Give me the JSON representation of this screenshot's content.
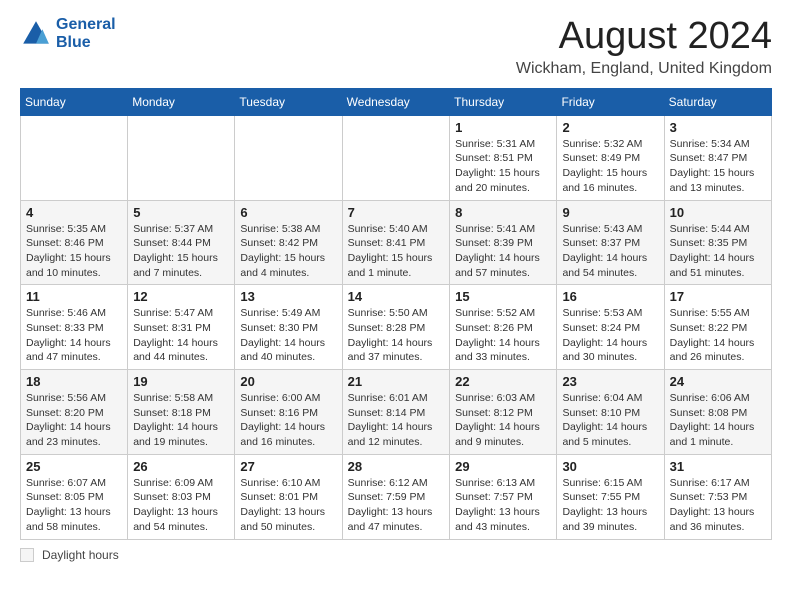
{
  "header": {
    "logo_line1": "General",
    "logo_line2": "Blue",
    "month_title": "August 2024",
    "location": "Wickham, England, United Kingdom"
  },
  "legend": {
    "label": "Daylight hours"
  },
  "days_of_week": [
    "Sunday",
    "Monday",
    "Tuesday",
    "Wednesday",
    "Thursday",
    "Friday",
    "Saturday"
  ],
  "weeks": [
    [
      {
        "day": "",
        "info": ""
      },
      {
        "day": "",
        "info": ""
      },
      {
        "day": "",
        "info": ""
      },
      {
        "day": "",
        "info": ""
      },
      {
        "day": "1",
        "info": "Sunrise: 5:31 AM\nSunset: 8:51 PM\nDaylight: 15 hours\nand 20 minutes."
      },
      {
        "day": "2",
        "info": "Sunrise: 5:32 AM\nSunset: 8:49 PM\nDaylight: 15 hours\nand 16 minutes."
      },
      {
        "day": "3",
        "info": "Sunrise: 5:34 AM\nSunset: 8:47 PM\nDaylight: 15 hours\nand 13 minutes."
      }
    ],
    [
      {
        "day": "4",
        "info": "Sunrise: 5:35 AM\nSunset: 8:46 PM\nDaylight: 15 hours\nand 10 minutes."
      },
      {
        "day": "5",
        "info": "Sunrise: 5:37 AM\nSunset: 8:44 PM\nDaylight: 15 hours\nand 7 minutes."
      },
      {
        "day": "6",
        "info": "Sunrise: 5:38 AM\nSunset: 8:42 PM\nDaylight: 15 hours\nand 4 minutes."
      },
      {
        "day": "7",
        "info": "Sunrise: 5:40 AM\nSunset: 8:41 PM\nDaylight: 15 hours\nand 1 minute."
      },
      {
        "day": "8",
        "info": "Sunrise: 5:41 AM\nSunset: 8:39 PM\nDaylight: 14 hours\nand 57 minutes."
      },
      {
        "day": "9",
        "info": "Sunrise: 5:43 AM\nSunset: 8:37 PM\nDaylight: 14 hours\nand 54 minutes."
      },
      {
        "day": "10",
        "info": "Sunrise: 5:44 AM\nSunset: 8:35 PM\nDaylight: 14 hours\nand 51 minutes."
      }
    ],
    [
      {
        "day": "11",
        "info": "Sunrise: 5:46 AM\nSunset: 8:33 PM\nDaylight: 14 hours\nand 47 minutes."
      },
      {
        "day": "12",
        "info": "Sunrise: 5:47 AM\nSunset: 8:31 PM\nDaylight: 14 hours\nand 44 minutes."
      },
      {
        "day": "13",
        "info": "Sunrise: 5:49 AM\nSunset: 8:30 PM\nDaylight: 14 hours\nand 40 minutes."
      },
      {
        "day": "14",
        "info": "Sunrise: 5:50 AM\nSunset: 8:28 PM\nDaylight: 14 hours\nand 37 minutes."
      },
      {
        "day": "15",
        "info": "Sunrise: 5:52 AM\nSunset: 8:26 PM\nDaylight: 14 hours\nand 33 minutes."
      },
      {
        "day": "16",
        "info": "Sunrise: 5:53 AM\nSunset: 8:24 PM\nDaylight: 14 hours\nand 30 minutes."
      },
      {
        "day": "17",
        "info": "Sunrise: 5:55 AM\nSunset: 8:22 PM\nDaylight: 14 hours\nand 26 minutes."
      }
    ],
    [
      {
        "day": "18",
        "info": "Sunrise: 5:56 AM\nSunset: 8:20 PM\nDaylight: 14 hours\nand 23 minutes."
      },
      {
        "day": "19",
        "info": "Sunrise: 5:58 AM\nSunset: 8:18 PM\nDaylight: 14 hours\nand 19 minutes."
      },
      {
        "day": "20",
        "info": "Sunrise: 6:00 AM\nSunset: 8:16 PM\nDaylight: 14 hours\nand 16 minutes."
      },
      {
        "day": "21",
        "info": "Sunrise: 6:01 AM\nSunset: 8:14 PM\nDaylight: 14 hours\nand 12 minutes."
      },
      {
        "day": "22",
        "info": "Sunrise: 6:03 AM\nSunset: 8:12 PM\nDaylight: 14 hours\nand 9 minutes."
      },
      {
        "day": "23",
        "info": "Sunrise: 6:04 AM\nSunset: 8:10 PM\nDaylight: 14 hours\nand 5 minutes."
      },
      {
        "day": "24",
        "info": "Sunrise: 6:06 AM\nSunset: 8:08 PM\nDaylight: 14 hours\nand 1 minute."
      }
    ],
    [
      {
        "day": "25",
        "info": "Sunrise: 6:07 AM\nSunset: 8:05 PM\nDaylight: 13 hours\nand 58 minutes."
      },
      {
        "day": "26",
        "info": "Sunrise: 6:09 AM\nSunset: 8:03 PM\nDaylight: 13 hours\nand 54 minutes."
      },
      {
        "day": "27",
        "info": "Sunrise: 6:10 AM\nSunset: 8:01 PM\nDaylight: 13 hours\nand 50 minutes."
      },
      {
        "day": "28",
        "info": "Sunrise: 6:12 AM\nSunset: 7:59 PM\nDaylight: 13 hours\nand 47 minutes."
      },
      {
        "day": "29",
        "info": "Sunrise: 6:13 AM\nSunset: 7:57 PM\nDaylight: 13 hours\nand 43 minutes."
      },
      {
        "day": "30",
        "info": "Sunrise: 6:15 AM\nSunset: 7:55 PM\nDaylight: 13 hours\nand 39 minutes."
      },
      {
        "day": "31",
        "info": "Sunrise: 6:17 AM\nSunset: 7:53 PM\nDaylight: 13 hours\nand 36 minutes."
      }
    ]
  ]
}
